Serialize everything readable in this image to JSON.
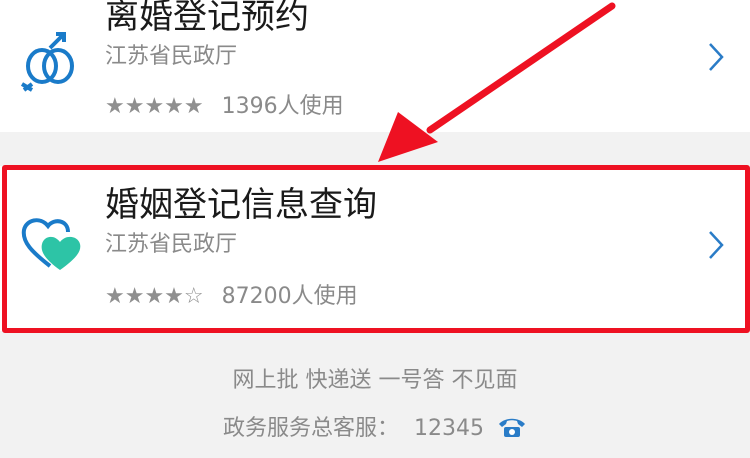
{
  "services": [
    {
      "title": "离婚登记预约",
      "org": "江苏省民政厅",
      "stars": "★★★★★",
      "stars_empty": "",
      "usage": "1396人使用",
      "icon": "marriage-rings-icon"
    },
    {
      "title": "婚姻登记信息查询",
      "org": "江苏省民政厅",
      "stars": "★★★★",
      "stars_empty": "☆",
      "usage": "87200人使用",
      "icon": "hearts-icon"
    }
  ],
  "footer": {
    "slogan": "网上批 快递送 一号答 不见面",
    "hotline_label": "政务服务总客服：",
    "hotline_number": "12345"
  },
  "colors": {
    "highlight_red": "#ee1122",
    "icon_blue": "#1a7bc9",
    "icon_teal": "#2dc4a6"
  }
}
